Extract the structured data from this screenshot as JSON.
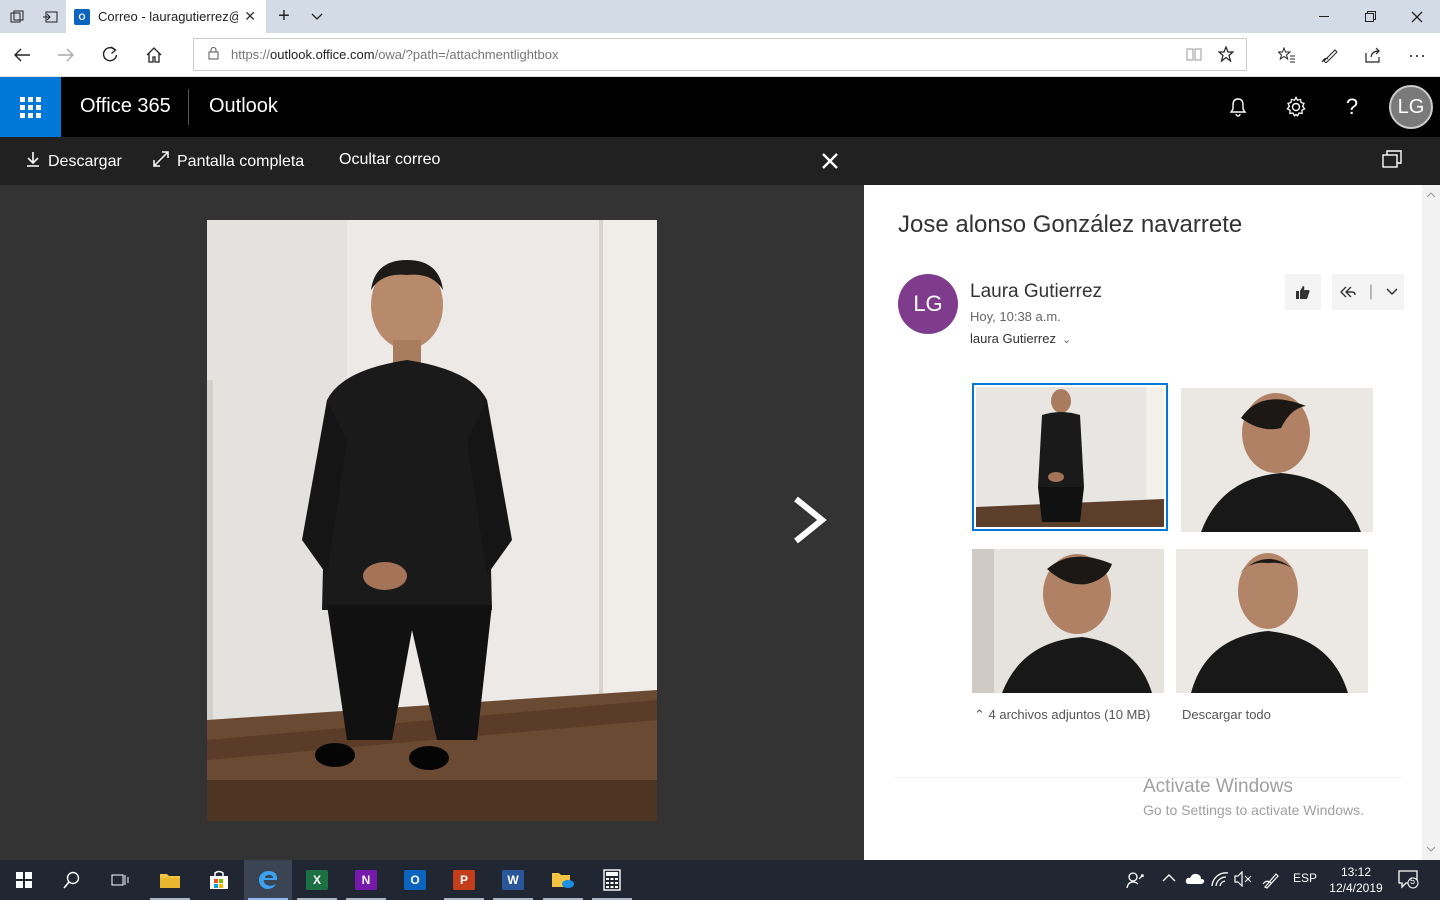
{
  "browser": {
    "tab_title": "Correo - lauragutierrez@",
    "favicon_label": "O",
    "url_prefix": "https://",
    "url_domain": "outlook.office.com",
    "url_path": "/owa/?path=/attachmentlightbox"
  },
  "header": {
    "brand": "Office 365",
    "app": "Outlook",
    "avatar_initials": "LG"
  },
  "lightbox": {
    "download": "Descargar",
    "fullscreen": "Pantalla completa",
    "hide_mail": "Ocultar correo"
  },
  "message": {
    "subject": "Jose alonso González navarrete",
    "sender_initials": "LG",
    "sender_name": "Laura Gutierrez",
    "sent_time": "Hoy, 10:38 a.m.",
    "recipient": "laura Gutierrez",
    "attachments_info": "4 archivos adjuntos (10 MB)",
    "download_all": "Descargar todo"
  },
  "watermark": {
    "title": "Activate Windows",
    "subtitle": "Go to Settings to activate Windows."
  },
  "taskbar": {
    "apps": [
      {
        "icon": "excel-icon",
        "letter": "X",
        "color": "#1d7044"
      },
      {
        "icon": "onenote-icon",
        "letter": "N",
        "color": "#7719aa"
      },
      {
        "icon": "outlook-icon",
        "letter": "O",
        "color": "#0a64c0"
      },
      {
        "icon": "powerpoint-icon",
        "letter": "P",
        "color": "#c43e1c"
      },
      {
        "icon": "word-icon",
        "letter": "W",
        "color": "#2b579a"
      }
    ],
    "language": "ESP",
    "time": "13:12",
    "date": "12/4/2019",
    "notifications": "5"
  }
}
